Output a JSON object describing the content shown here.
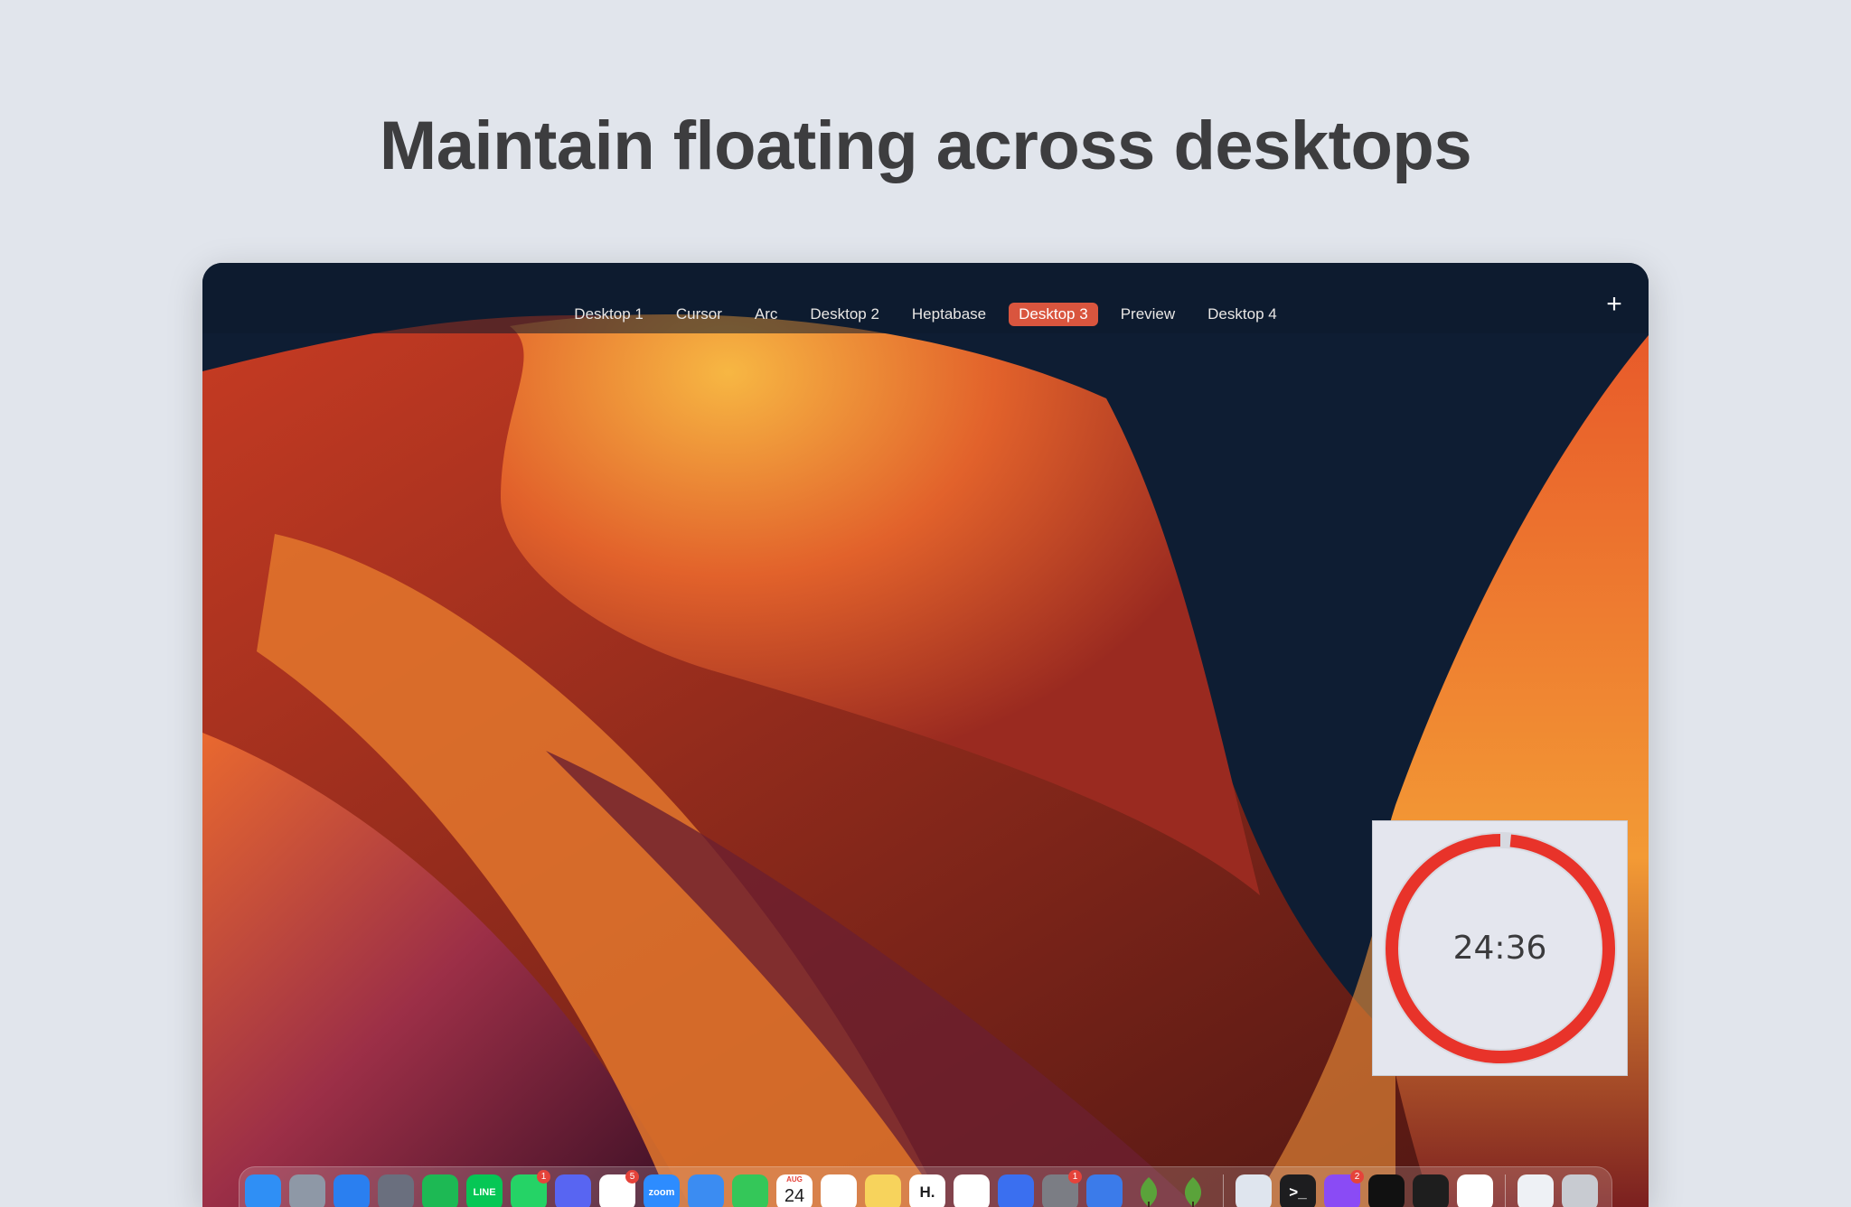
{
  "headline": "Maintain floating across desktops",
  "spaces_bar": {
    "tabs": [
      {
        "label": "Desktop 1",
        "active": false
      },
      {
        "label": "Cursor",
        "active": false
      },
      {
        "label": "Arc",
        "active": false
      },
      {
        "label": "Desktop 2",
        "active": false
      },
      {
        "label": "Heptabase",
        "active": false
      },
      {
        "label": "Desktop 3",
        "active": true
      },
      {
        "label": "Preview",
        "active": false
      },
      {
        "label": "Desktop 4",
        "active": false
      }
    ],
    "add_icon": "plus-icon",
    "add_label": "+"
  },
  "timer": {
    "time": "24:36",
    "ring_color": "#e8332a",
    "remaining_fraction": 0.985
  },
  "dock": {
    "apps": [
      {
        "name": "finder",
        "icon": "finder-icon",
        "color": "#2f8ff5",
        "glyph": "",
        "running": true
      },
      {
        "name": "launchpad",
        "icon": "launchpad-icon",
        "color": "#8e98a6",
        "glyph": "",
        "running": false
      },
      {
        "name": "safari",
        "icon": "safari-icon",
        "color": "#2a7ff0",
        "glyph": "",
        "running": true
      },
      {
        "name": "pixelmator",
        "icon": "pixelmator-icon",
        "color": "#6a6f7e",
        "glyph": "",
        "running": true
      },
      {
        "name": "spotify",
        "icon": "spotify-icon",
        "color": "#1db954",
        "glyph": "",
        "running": true
      },
      {
        "name": "line",
        "icon": "line-icon",
        "color": "#06c755",
        "glyph": "LINE",
        "running": true
      },
      {
        "name": "whatsapp",
        "icon": "whatsapp-icon",
        "color": "#25d366",
        "glyph": "",
        "running": true,
        "badge": "1"
      },
      {
        "name": "discord",
        "icon": "discord-icon",
        "color": "#5865f2",
        "glyph": "",
        "running": true
      },
      {
        "name": "slack",
        "icon": "slack-icon",
        "color": "#ffffff",
        "glyph": "",
        "running": true,
        "badge": "5"
      },
      {
        "name": "zoom",
        "icon": "zoom-icon",
        "color": "#2d8cff",
        "glyph": "zoom",
        "running": false
      },
      {
        "name": "mail",
        "icon": "mail-icon",
        "color": "#3b8cf2",
        "glyph": "",
        "running": false
      },
      {
        "name": "facetime",
        "icon": "facetime-icon",
        "color": "#34c759",
        "glyph": "",
        "running": false
      },
      {
        "name": "calendar",
        "icon": "calendar-icon",
        "color": "#ffffff",
        "glyph": "24",
        "month": "AUG",
        "running": false
      },
      {
        "name": "reminders",
        "icon": "reminders-icon",
        "color": "#ffffff",
        "glyph": "",
        "running": false
      },
      {
        "name": "notes",
        "icon": "notes-icon",
        "color": "#f7d35c",
        "glyph": "",
        "running": true
      },
      {
        "name": "heptabase",
        "icon": "heptabase-icon",
        "color": "#ffffff",
        "glyph": "H.",
        "running": true
      },
      {
        "name": "freeform",
        "icon": "freeform-icon",
        "color": "#ffffff",
        "glyph": "",
        "running": false
      },
      {
        "name": "arc",
        "icon": "arc-icon",
        "color": "#3a6ff0",
        "glyph": "",
        "running": true
      },
      {
        "name": "system-settings",
        "icon": "settings-icon",
        "color": "#7b7d84",
        "glyph": "",
        "running": false,
        "badge": "1"
      },
      {
        "name": "cat-app",
        "icon": "cat-icon",
        "color": "#3b7bea",
        "glyph": "",
        "running": false
      },
      {
        "name": "tree-app-1",
        "icon": "tree-icon",
        "color": "transparent",
        "glyph": "",
        "running": false
      },
      {
        "name": "tree-app-2",
        "icon": "tree-icon",
        "color": "transparent",
        "glyph": "",
        "running": false
      },
      {
        "name": "separator-1",
        "separator": true
      },
      {
        "name": "preview",
        "icon": "preview-icon",
        "color": "#dfe5ee",
        "glyph": "",
        "running": true
      },
      {
        "name": "terminal",
        "icon": "terminal-icon",
        "color": "#1d1d1f",
        "glyph": ">_",
        "running": true
      },
      {
        "name": "messenger",
        "icon": "messenger-icon",
        "color": "#8a4bf5",
        "glyph": "",
        "running": true,
        "badge": "2"
      },
      {
        "name": "cursor",
        "icon": "cursor-icon",
        "color": "#111111",
        "glyph": "",
        "running": true
      },
      {
        "name": "figma",
        "icon": "figma-icon",
        "color": "#1e1e1e",
        "glyph": "",
        "running": true
      },
      {
        "name": "chrome",
        "icon": "chrome-icon",
        "color": "#ffffff",
        "glyph": "",
        "running": true
      },
      {
        "name": "separator-2",
        "separator": true
      },
      {
        "name": "downloads",
        "icon": "downloads-icon",
        "color": "#eef1f5",
        "glyph": "",
        "running": false
      },
      {
        "name": "trash",
        "icon": "trash-icon",
        "color": "#c8cbd1",
        "glyph": "",
        "running": false
      }
    ]
  }
}
